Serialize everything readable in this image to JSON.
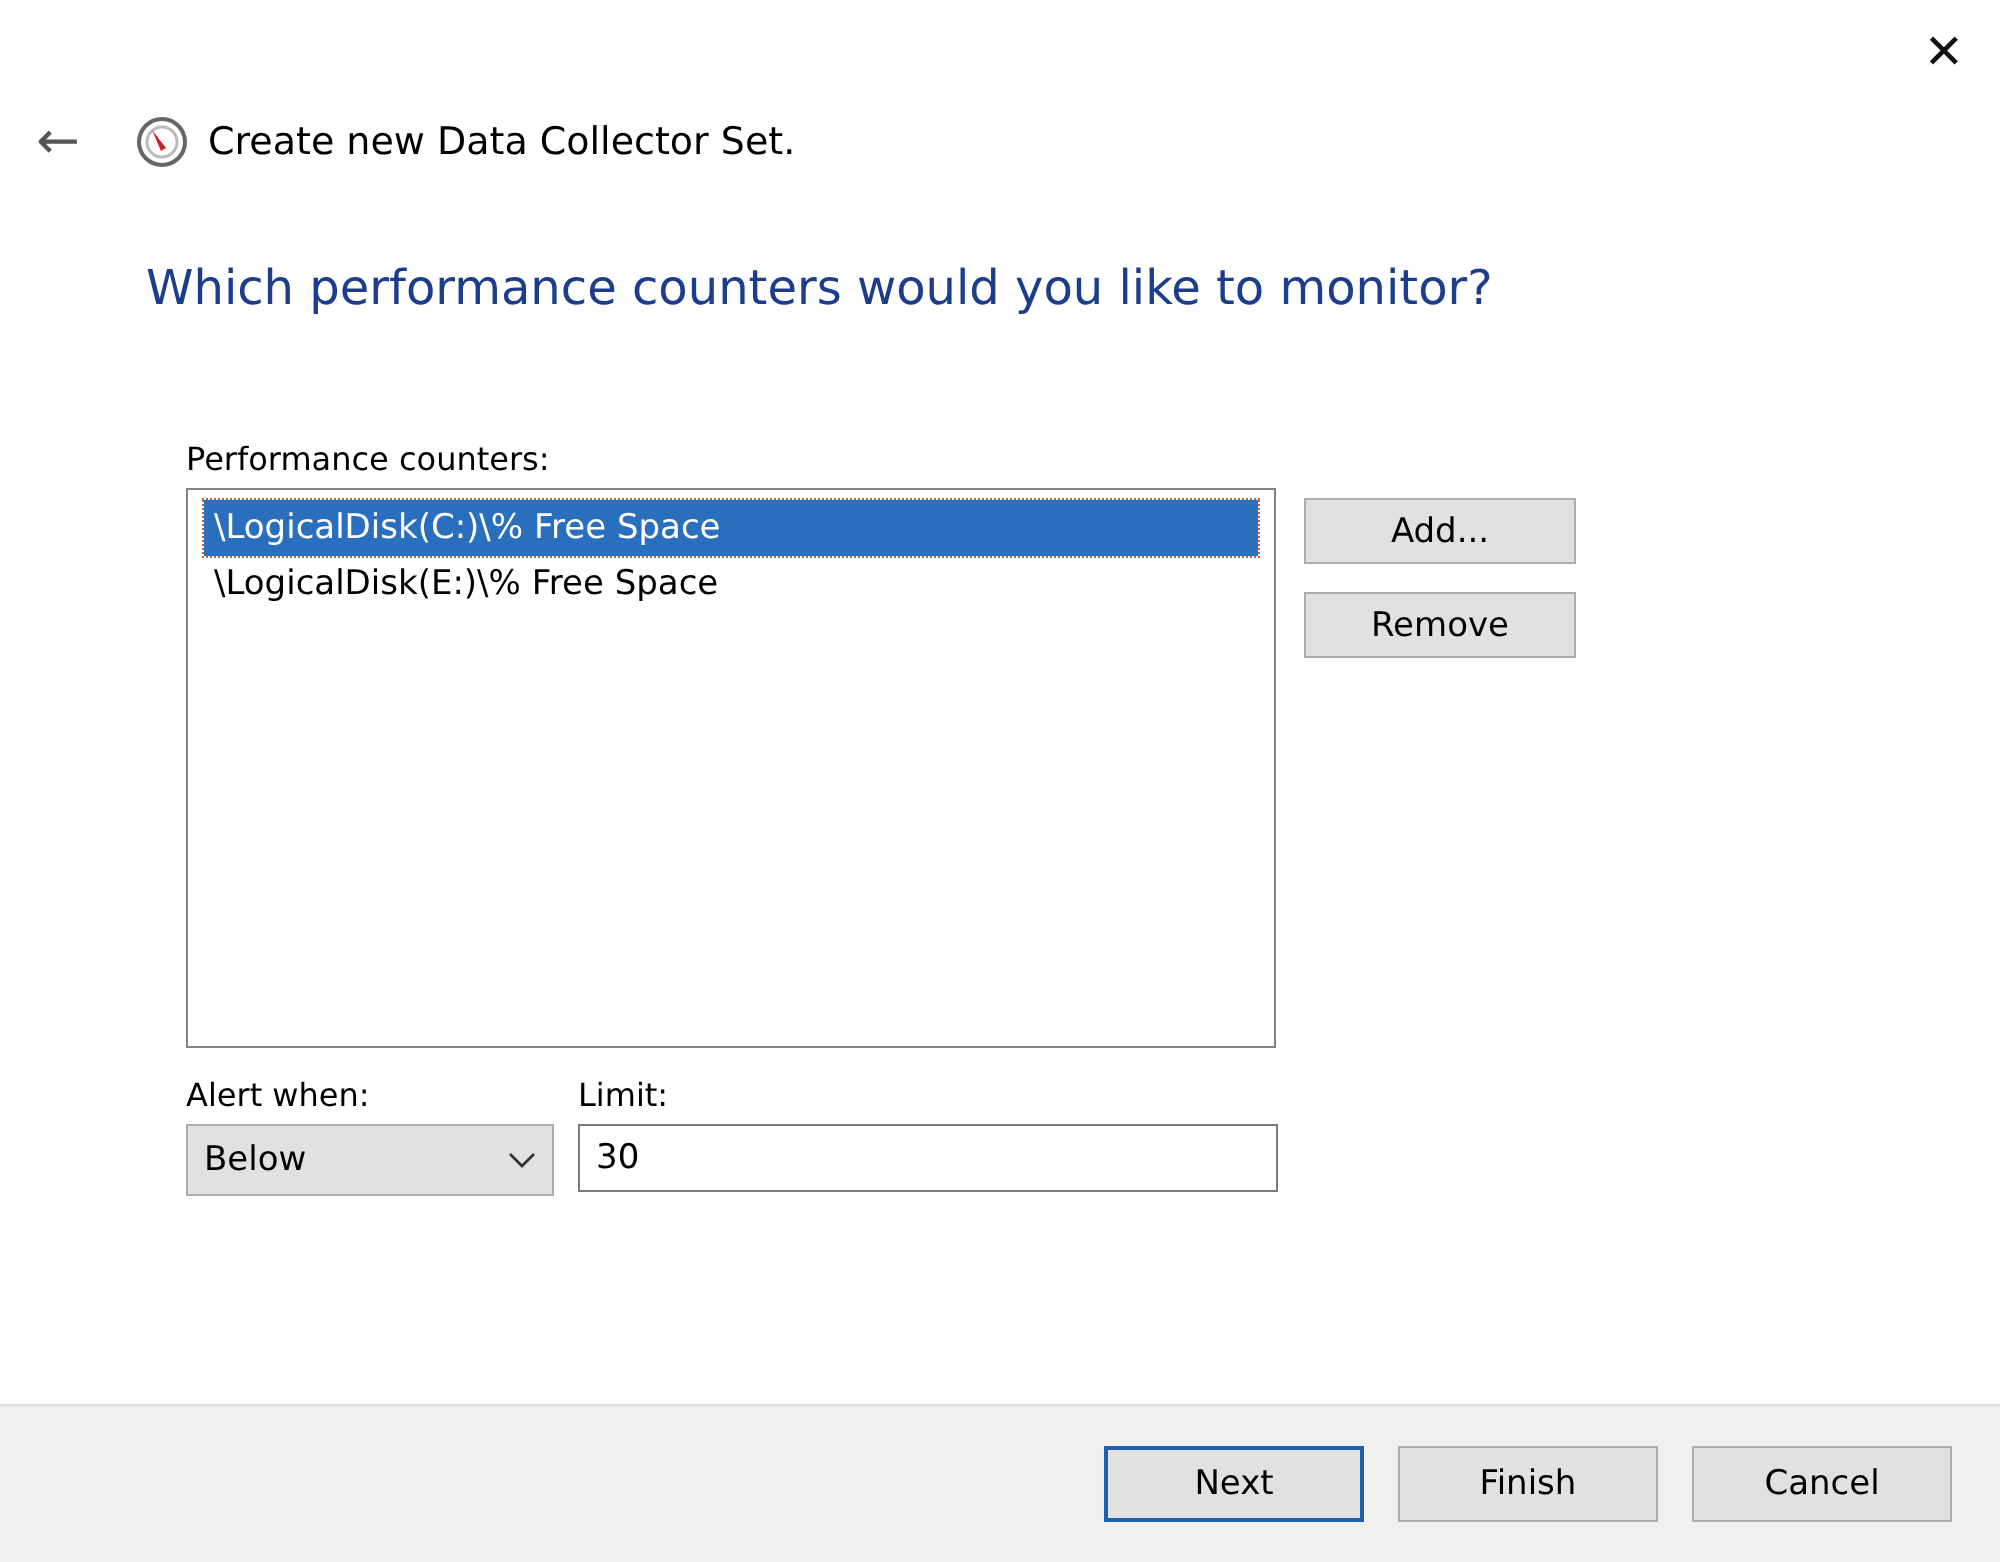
{
  "window": {
    "close": "✕"
  },
  "header": {
    "back": "←",
    "title": "Create new Data Collector Set."
  },
  "heading": "Which performance counters would you like to monitor?",
  "counters": {
    "label": "Performance counters:",
    "items": [
      {
        "text": "\\LogicalDisk(C:)\\% Free Space",
        "selected": true
      },
      {
        "text": "\\LogicalDisk(E:)\\% Free Space",
        "selected": false
      }
    ],
    "buttons": [
      {
        "label": "Add..."
      },
      {
        "label": "Remove"
      }
    ]
  },
  "alert": {
    "label": "Alert when:",
    "value": "Below"
  },
  "limit": {
    "label": "Limit:",
    "value": "30"
  },
  "footer_buttons": [
    {
      "label": "Next",
      "default": true
    },
    {
      "label": "Finish",
      "default": false
    },
    {
      "label": "Cancel",
      "default": false
    }
  ]
}
